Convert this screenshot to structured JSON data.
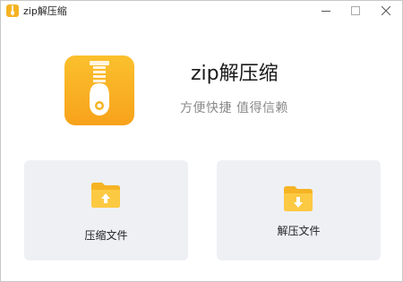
{
  "window": {
    "title": "zip解压缩",
    "controls": [
      "minimize",
      "maximize",
      "close"
    ]
  },
  "header": {
    "app_name": "zip解压缩",
    "tagline": "方便快捷 值得信赖",
    "logo_icon": "zip-archive-icon"
  },
  "actions": [
    {
      "label": "压缩文件",
      "icon": "folder-upload-icon"
    },
    {
      "label": "解压文件",
      "icon": "folder-download-icon"
    }
  ],
  "colors": {
    "brand_yellow": "#f5b324",
    "brand_orange": "#f8a21a",
    "card_bg": "#eef0f4"
  }
}
